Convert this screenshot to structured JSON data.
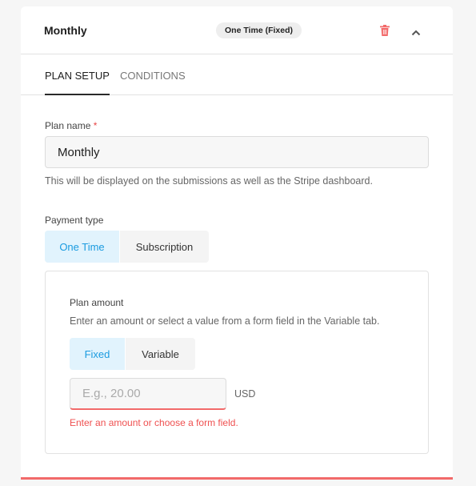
{
  "header": {
    "title": "Monthly",
    "badge": "One Time (Fixed)",
    "delete_icon": "trash-icon",
    "collapse_icon": "chevron-up-icon"
  },
  "tabs": [
    {
      "label": "PLAN SETUP",
      "active": true
    },
    {
      "label": "CONDITIONS",
      "active": false
    }
  ],
  "plan_name": {
    "label": "Plan name",
    "required": "*",
    "value": "Monthly",
    "help": "This will be displayed on the submissions as well as the Stripe dashboard."
  },
  "payment_type": {
    "label": "Payment type",
    "options": [
      "One Time",
      "Subscription"
    ],
    "selected": "One Time"
  },
  "plan_amount": {
    "label": "Plan amount",
    "help": "Enter an amount or select a value from a form field in the Variable tab.",
    "options": [
      "Fixed",
      "Variable"
    ],
    "selected": "Fixed",
    "placeholder": "E.g., 20.00",
    "value": "",
    "currency": "USD",
    "error": "Enter an amount or choose a form field."
  },
  "colors": {
    "accent": "#1a9be0",
    "error": "#ef5050"
  }
}
